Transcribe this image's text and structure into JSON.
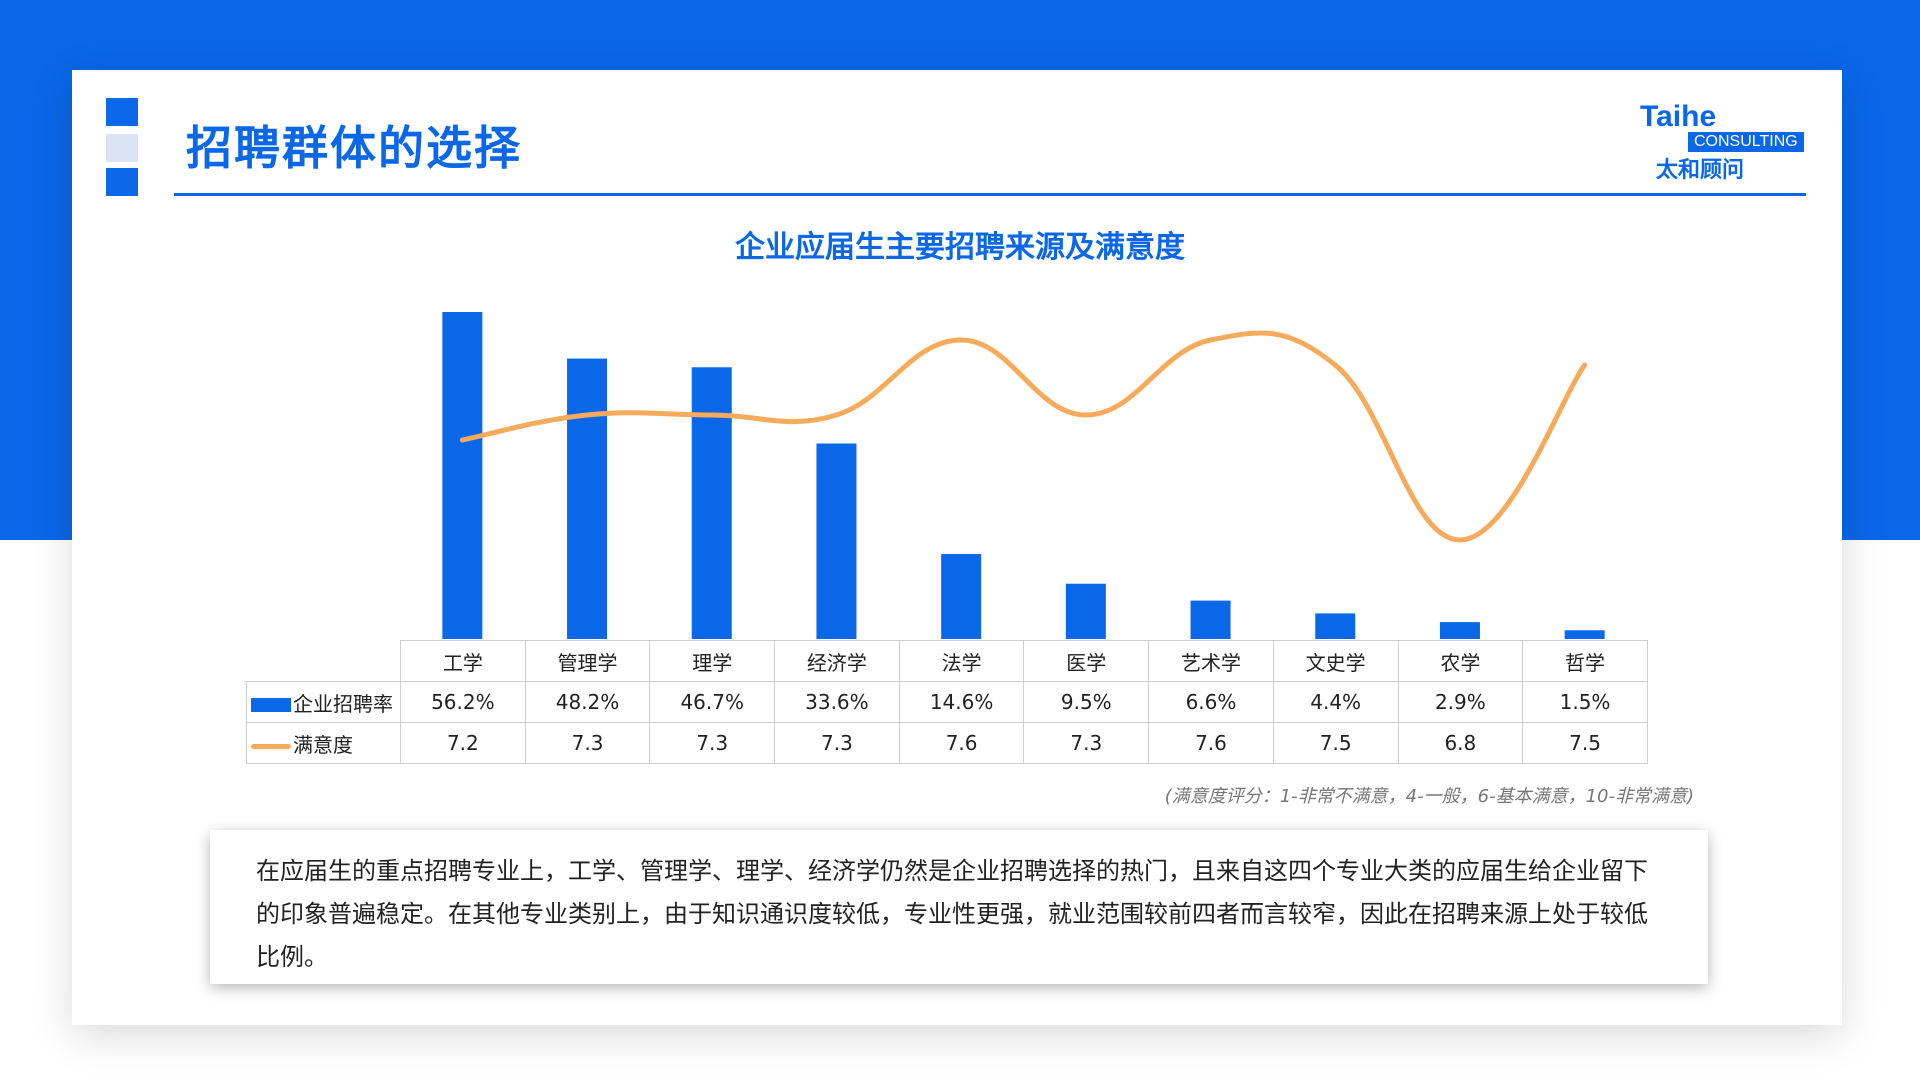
{
  "header": {
    "title": "招聘群体的选择"
  },
  "logo": {
    "en": "Taihe",
    "badge": "CONSULTING",
    "cn": "太和顾问"
  },
  "colors": {
    "accent": "#0a67e8",
    "line": "#f6ab5c"
  },
  "chart_data": {
    "type": "bar",
    "title": "企业应届生主要招聘来源及满意度",
    "categories": [
      "工学",
      "管理学",
      "理学",
      "经济学",
      "法学",
      "医学",
      "艺术学",
      "文史学",
      "农学",
      "哲学"
    ],
    "series": [
      {
        "name": "企业招聘率",
        "type": "bar",
        "color": "#0a67e8",
        "values": [
          56.2,
          48.2,
          46.7,
          33.6,
          14.6,
          9.5,
          6.6,
          4.4,
          2.9,
          1.5
        ],
        "labels": [
          "56.2%",
          "48.2%",
          "46.7%",
          "33.6%",
          "14.6%",
          "9.5%",
          "6.6%",
          "4.4%",
          "2.9%",
          "1.5%"
        ]
      },
      {
        "name": "满意度",
        "type": "line",
        "color": "#f6ab5c",
        "values": [
          7.2,
          7.3,
          7.3,
          7.3,
          7.6,
          7.3,
          7.6,
          7.5,
          6.8,
          7.5
        ],
        "labels": [
          "7.2",
          "7.3",
          "7.3",
          "7.3",
          "7.6",
          "7.3",
          "7.6",
          "7.5",
          "6.8",
          "7.5"
        ]
      }
    ],
    "ylim_bar": [
      0,
      56.2
    ],
    "ylim_line": [
      6.8,
      7.6
    ],
    "legend": "data-table"
  },
  "note": "(满意度评分：1-非常不满意，4-一般，6-基本满意，10-非常满意)",
  "summary": "在应届生的重点招聘专业上，工学、管理学、理学、经济学仍然是企业招聘选择的热门，且来自这四个专业大类的应届生给企业留下的印象普遍稳定。在其他专业类别上，由于知识通识度较低，专业性更强，就业范围较前四者而言较窄，因此在招聘来源上处于较低比例。"
}
